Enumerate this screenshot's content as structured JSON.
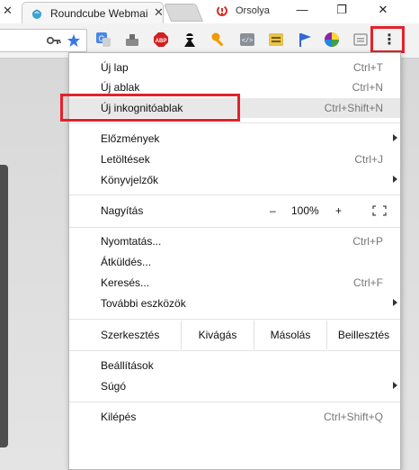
{
  "browser": {
    "tab_title": "Roundcube Webmail",
    "profile_name": "Orsolya",
    "tab_close_glyph": "✕",
    "window_controls": {
      "minimize": "—",
      "restore": "❐",
      "close": "✕"
    }
  },
  "toolbar": {
    "extensions": [
      "key-icon",
      "bookmark-star-icon",
      "translate-icon",
      "tool-icon",
      "adblock-plus-icon",
      "ninja-icon",
      "key-orange-icon",
      "code-icon",
      "extension-icon",
      "flag-icon",
      "color-wheel-icon",
      "reader-icon"
    ],
    "adblock_label": "ABP",
    "code_label": "</>",
    "menu_glyph": "⋮"
  },
  "colors": {
    "highlight": "#e3222b",
    "menu_hover": "#e8e8e8"
  },
  "menu": {
    "new_tab": {
      "label": "Új lap",
      "shortcut": "Ctrl+T"
    },
    "new_window": {
      "label": "Új ablak",
      "shortcut": "Ctrl+N"
    },
    "new_incognito": {
      "label": "Új inkognitóablak",
      "shortcut": "Ctrl+Shift+N"
    },
    "history": {
      "label": "Előzmények"
    },
    "downloads": {
      "label": "Letöltések",
      "shortcut": "Ctrl+J"
    },
    "bookmarks": {
      "label": "Könyvjelzők"
    },
    "zoom": {
      "label": "Nagyítás",
      "minus": "–",
      "value": "100%",
      "plus": "+"
    },
    "print": {
      "label": "Nyomtatás...",
      "shortcut": "Ctrl+P"
    },
    "cast": {
      "label": "Átküldés..."
    },
    "find": {
      "label": "Keresés...",
      "shortcut": "Ctrl+F"
    },
    "more_tools": {
      "label": "További eszközök"
    },
    "edit": {
      "label": "Szerkesztés",
      "cut": "Kivágás",
      "copy": "Másolás",
      "paste": "Beillesztés"
    },
    "settings": {
      "label": "Beállítások"
    },
    "help": {
      "label": "Súgó"
    },
    "exit": {
      "label": "Kilépés",
      "shortcut": "Ctrl+Shift+Q"
    }
  }
}
